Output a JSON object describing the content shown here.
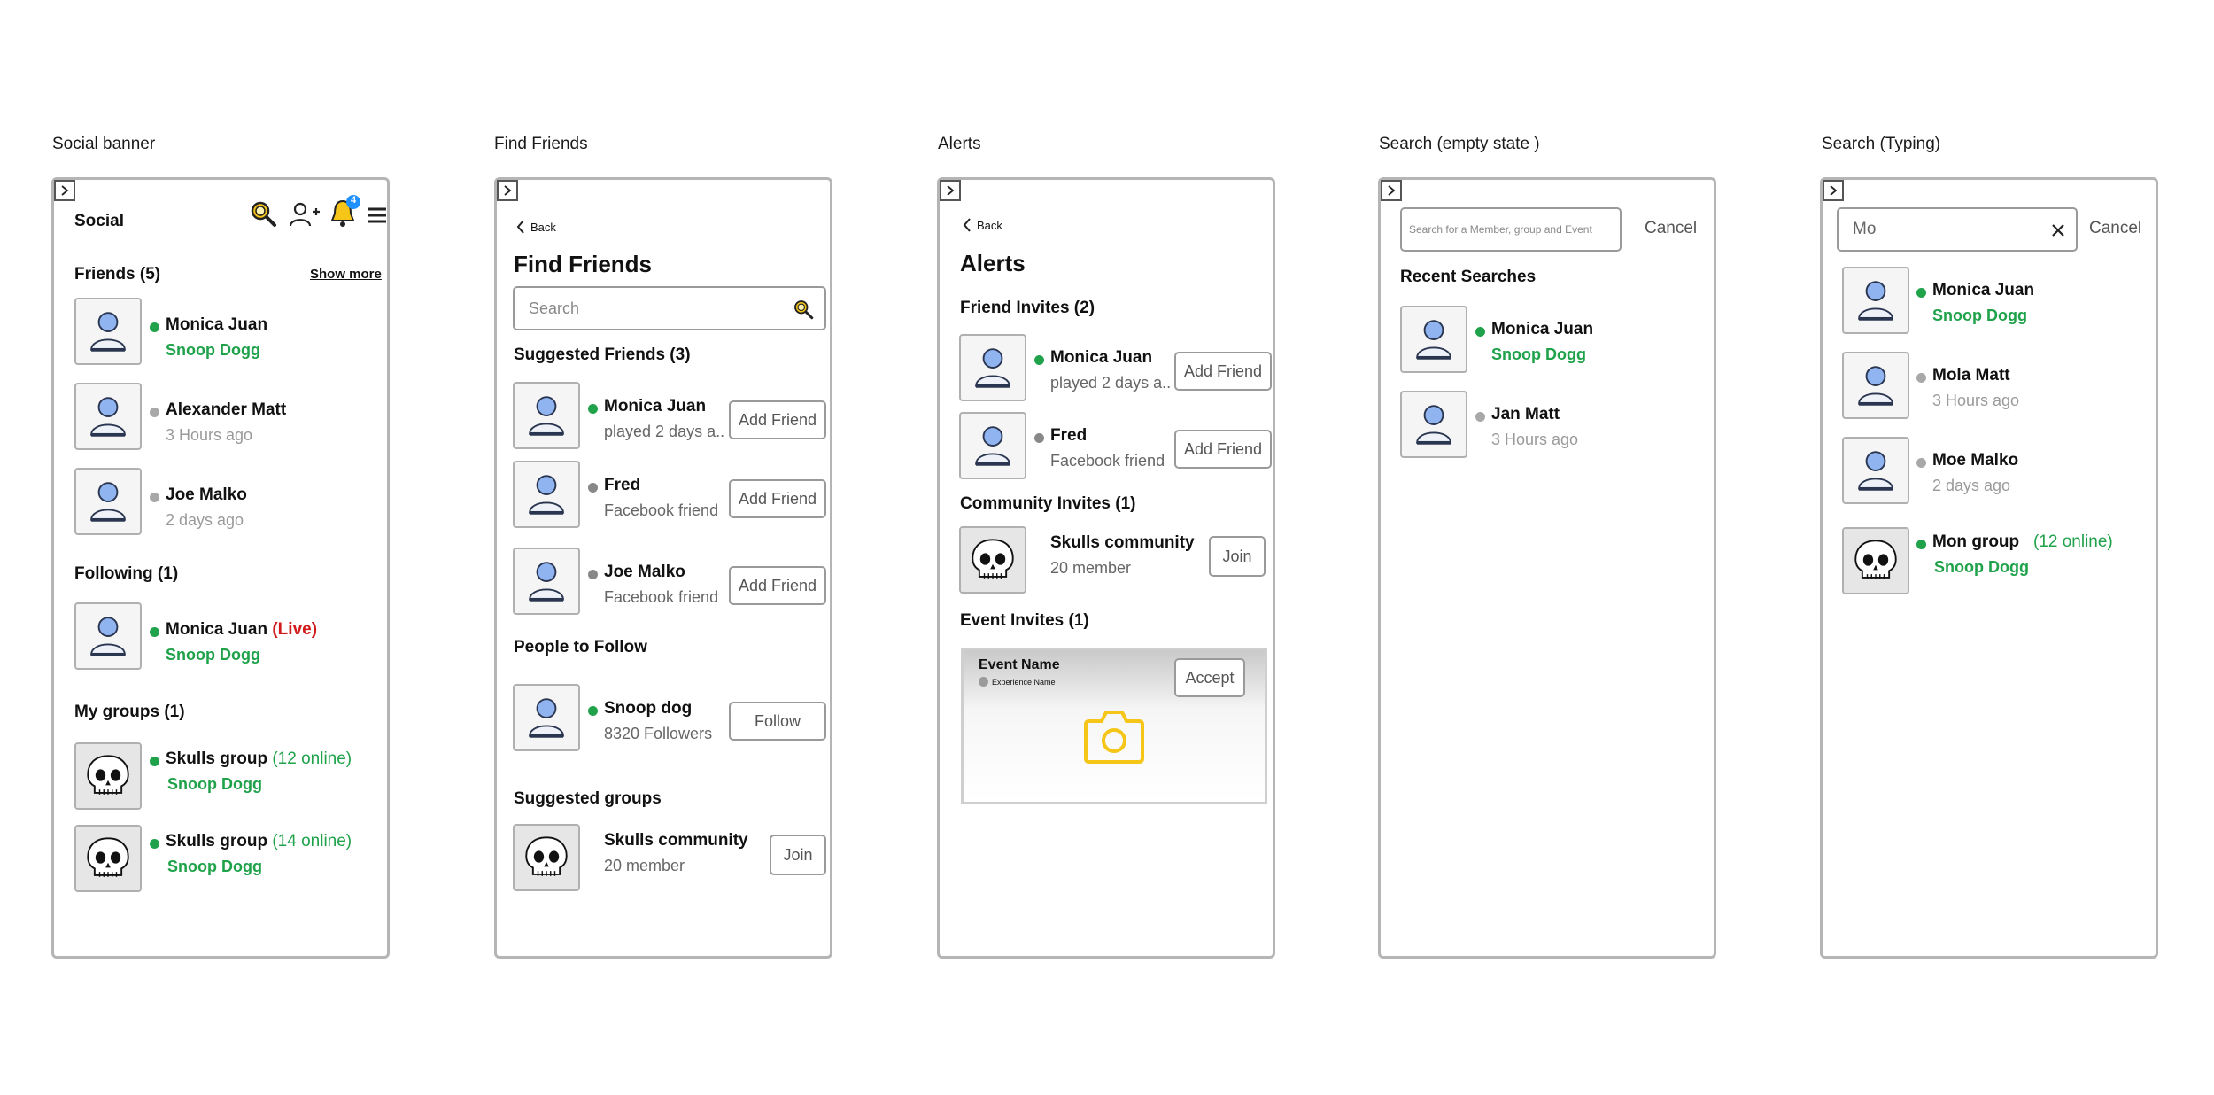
{
  "frames": {
    "social": {
      "title": "Social banner",
      "header": "Social",
      "badge": "4",
      "friends_title": "Friends (5)",
      "show_more": "Show more",
      "friends": [
        {
          "name": "Monica Juan",
          "sub": "Snoop Dogg",
          "status": "online"
        },
        {
          "name": "Alexander Matt",
          "sub": "3 Hours ago",
          "status": "offline"
        },
        {
          "name": "Joe Malko",
          "sub": "2 days ago",
          "status": "offline"
        }
      ],
      "following_title": "Following (1)",
      "following": [
        {
          "name": "Monica Juan",
          "live": "(Live)",
          "sub": "Snoop Dogg"
        }
      ],
      "groups_title": "My groups (1)",
      "groups": [
        {
          "name": "Skulls group",
          "online": "(12 online)",
          "sub": "Snoop Dogg"
        },
        {
          "name": "Skulls group",
          "online": "(14 online)",
          "sub": "Snoop Dogg"
        }
      ]
    },
    "find": {
      "title": "Find Friends",
      "back": "Back",
      "heading": "Find Friends",
      "search_placeholder": "Search",
      "suggested_title": "Suggested Friends (3)",
      "suggested": [
        {
          "name": "Monica Juan",
          "sub": "played 2 days a..",
          "status": "online",
          "action": "Add Friend"
        },
        {
          "name": "Fred",
          "sub": "Facebook friend",
          "status": "offline",
          "action": "Add Friend"
        },
        {
          "name": "Joe Malko",
          "sub": "Facebook friend",
          "status": "offline",
          "action": "Add Friend"
        }
      ],
      "people_title": "People to Follow",
      "people": [
        {
          "name": "Snoop dog",
          "sub": "8320 Followers",
          "action": "Follow"
        }
      ],
      "groups_title": "Suggested groups",
      "groups": [
        {
          "name": "Skulls community",
          "sub": "20 member",
          "action": "Join"
        }
      ]
    },
    "alerts": {
      "title": "Alerts",
      "back": "Back",
      "heading": "Alerts",
      "friend_invites_title": "Friend Invites (2)",
      "friend_invites": [
        {
          "name": "Monica Juan",
          "sub": "played 2 days a..",
          "status": "online",
          "action": "Add Friend"
        },
        {
          "name": "Fred",
          "sub": "Facebook friend",
          "status": "offline",
          "action": "Add Friend"
        }
      ],
      "community_title": "Community Invites (1)",
      "community": [
        {
          "name": "Skulls community",
          "sub": "20 member",
          "action": "Join"
        }
      ],
      "event_title": "Event Invites (1)",
      "event": {
        "name": "Event Name",
        "experience": "Experience Name",
        "action": "Accept"
      }
    },
    "search_empty": {
      "title": "Search (empty state )",
      "placeholder": "Search for a Member, group and Event",
      "cancel": "Cancel",
      "recent_title": "Recent Searches",
      "recent": [
        {
          "name": "Monica Juan",
          "sub": "Snoop Dogg",
          "status": "online"
        },
        {
          "name": "Jan Matt",
          "sub": "3 Hours ago",
          "status": "offline"
        }
      ]
    },
    "search_typing": {
      "title": "Search (Typing)",
      "value": "Mo",
      "cancel": "Cancel",
      "results": [
        {
          "name": "Monica Juan",
          "sub": "Snoop Dogg",
          "status": "online"
        },
        {
          "name": "Mola Matt",
          "sub": "3 Hours ago",
          "status": "offline"
        },
        {
          "name": "Moe Malko",
          "sub": "2 days ago",
          "status": "offline"
        },
        {
          "name": "Mon group",
          "online": "(12 online)",
          "sub": "Snoop Dogg",
          "status": "online"
        }
      ]
    }
  },
  "colors": {
    "online": "#1fa24a",
    "offline": "#a8a8a8",
    "live": "#d21a1a",
    "accent": "#f5c518",
    "badge": "#1e90ff"
  }
}
